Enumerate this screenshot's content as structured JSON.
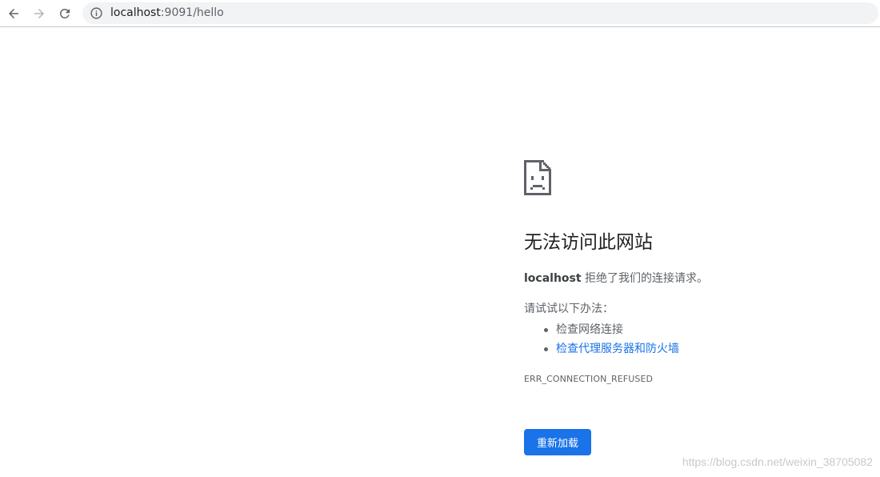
{
  "browser": {
    "url_host": "localhost",
    "url_path": ":9091/hello",
    "icons": {
      "back": "arrow-left-icon",
      "forward": "arrow-right-icon",
      "reload": "reload-icon",
      "info": "info-circle-icon"
    }
  },
  "error_page": {
    "icon": "sad-page-icon",
    "heading": "无法访问此网站",
    "summary_host": "localhost",
    "summary_text": " 拒绝了我们的连接请求。",
    "suggest_title": "请试试以下办法：",
    "suggestions": [
      {
        "label": "检查网络连接",
        "link": false
      },
      {
        "label": "检查代理服务器和防火墙",
        "link": true
      }
    ],
    "error_code": "ERR_CONNECTION_REFUSED",
    "reload_label": "重新加载"
  },
  "watermark": "https://blog.csdn.net/weixin_38705082",
  "colors": {
    "accent": "#1a73e8",
    "text_primary": "#202124",
    "text_secondary": "#5f6368",
    "omnibox_bg": "#f1f3f4"
  }
}
